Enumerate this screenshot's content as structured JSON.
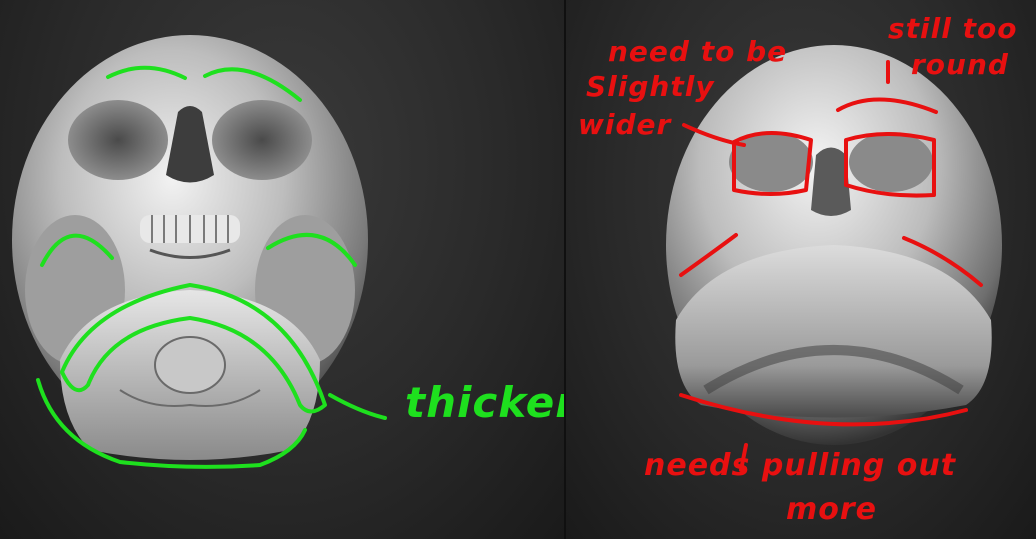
{
  "panels": [
    {
      "subject": "skull reference model"
    },
    {
      "subject": "sculpted head model"
    }
  ],
  "annotations": {
    "green_color": "#1ee01e",
    "red_color": "#e81010",
    "thicker": "thicker",
    "need_line1": "need to be",
    "need_line2": "Slightly",
    "need_line3": "wider",
    "still_line1": "still too",
    "still_line2": "round",
    "pull_line1": "needs pulling out",
    "pull_line2": "more"
  }
}
